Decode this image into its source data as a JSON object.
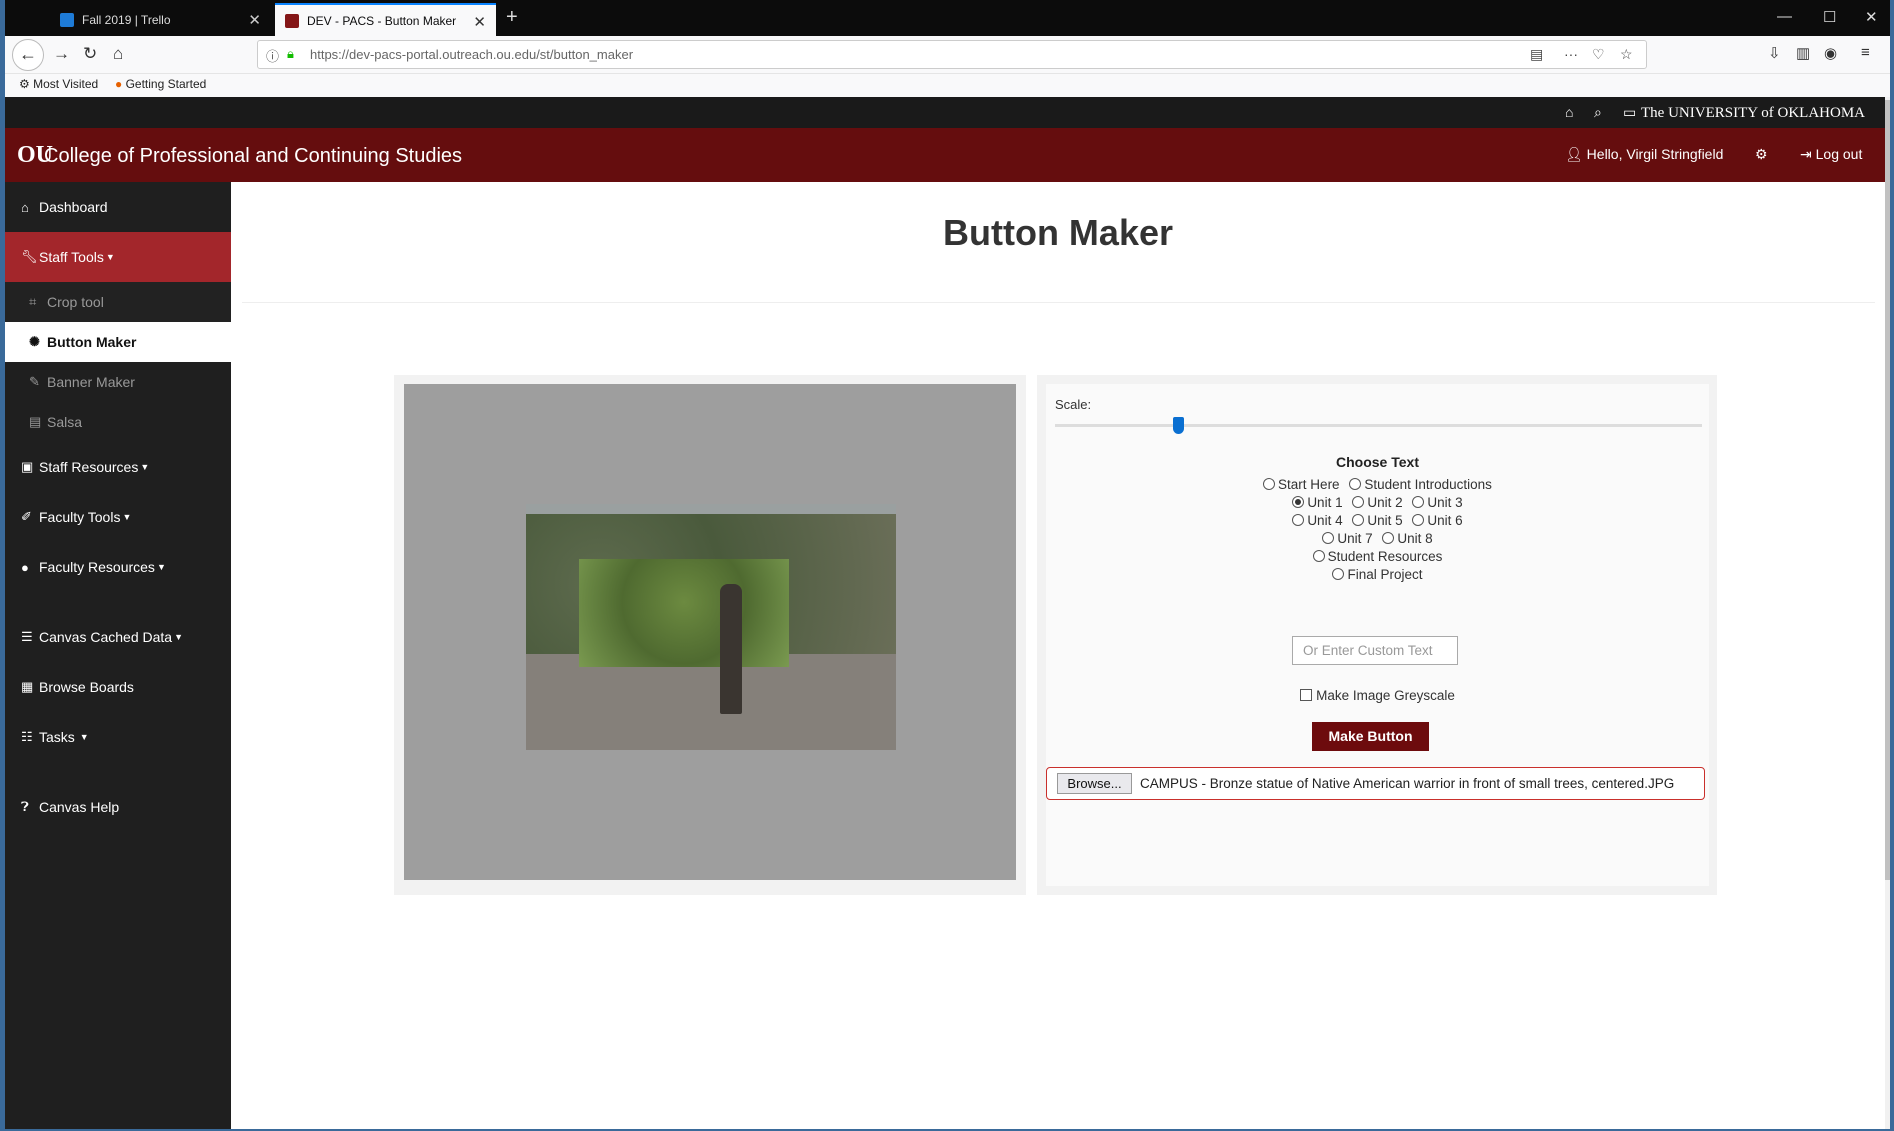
{
  "browser": {
    "tabs": [
      {
        "title": "Fall 2019 | Trello"
      },
      {
        "title": "DEV - PACS - Button Maker"
      }
    ],
    "url": "https://dev-pacs-portal.outreach.ou.edu/st/button_maker",
    "bookmarks": [
      "Most Visited",
      "Getting Started"
    ]
  },
  "topbar": {
    "university": "The UNIVERSITY of OKLAHOMA"
  },
  "header": {
    "logo": "OU",
    "title": "College of Professional and Continuing Studies",
    "greeting": "Hello, Virgil Stringfield",
    "logout": "Log out"
  },
  "sidebar": {
    "items": [
      {
        "label": "Dashboard"
      },
      {
        "label": "Staff Tools"
      },
      {
        "label": "Crop tool"
      },
      {
        "label": "Button Maker"
      },
      {
        "label": "Banner Maker"
      },
      {
        "label": "Salsa"
      },
      {
        "label": "Staff Resources"
      },
      {
        "label": "Faculty Tools"
      },
      {
        "label": "Faculty Resources"
      },
      {
        "label": "Canvas Cached Data"
      },
      {
        "label": "Browse Boards"
      },
      {
        "label": "Tasks"
      },
      {
        "label": "Canvas Help"
      }
    ]
  },
  "main": {
    "title": "Button Maker",
    "scale_label": "Scale:",
    "scale_value": 0.2,
    "choose_text": "Choose Text",
    "options": [
      {
        "label": "Start Here",
        "checked": false
      },
      {
        "label": "Student Introductions",
        "checked": false
      },
      {
        "label": "Unit 1",
        "checked": true
      },
      {
        "label": "Unit 2",
        "checked": false
      },
      {
        "label": "Unit 3",
        "checked": false
      },
      {
        "label": "Unit 4",
        "checked": false
      },
      {
        "label": "Unit 5",
        "checked": false
      },
      {
        "label": "Unit 6",
        "checked": false
      },
      {
        "label": "Unit 7",
        "checked": false
      },
      {
        "label": "Unit 8",
        "checked": false
      },
      {
        "label": "Student Resources",
        "checked": false
      },
      {
        "label": "Final Project",
        "checked": false
      }
    ],
    "custom_placeholder": "Or Enter Custom Text",
    "greyscale_label": "Make Image Greyscale",
    "greyscale_checked": false,
    "make_button": "Make Button",
    "browse_label": "Browse...",
    "file_name": "CAMPUS - Bronze statue of Native American warrior in front of small trees, centered.JPG"
  }
}
